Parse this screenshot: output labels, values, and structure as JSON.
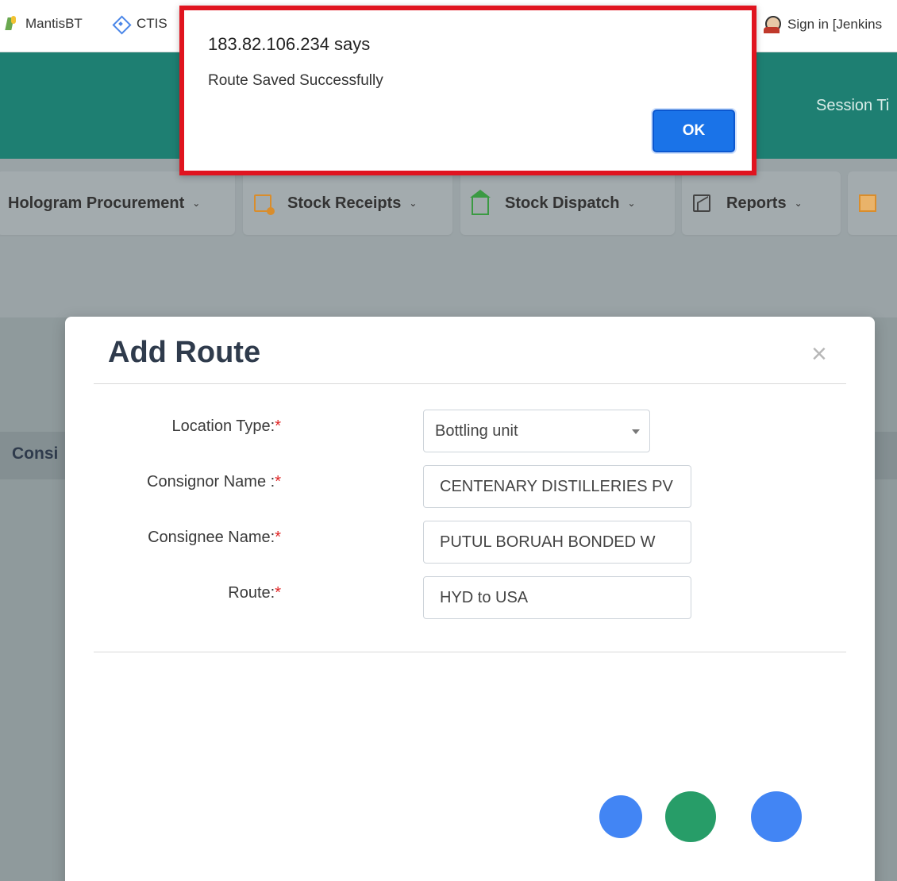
{
  "bookmarks": {
    "mantis": "MantisBT",
    "ctis": "CTIS",
    "jenkins": "Sign in [Jenkins"
  },
  "header": {
    "session": "Session Ti"
  },
  "nav": {
    "items": [
      {
        "label": "Hologram Procurement"
      },
      {
        "label": "Stock Receipts"
      },
      {
        "label": "Stock Dispatch"
      },
      {
        "label": "Reports"
      }
    ],
    "caret": "⌄"
  },
  "background": {
    "table_header": "Consi"
  },
  "modal": {
    "title": "Add Route",
    "close": "×",
    "fields": {
      "location_type": {
        "label": "Location Type:",
        "value": "Bottling unit"
      },
      "consignor": {
        "label": "Consignor Name :",
        "value": "CENTENARY DISTILLERIES PV"
      },
      "consignee": {
        "label": "Consignee Name:",
        "value": "PUTUL BORUAH BONDED W"
      },
      "route": {
        "label": "Route:",
        "value": "HYD to USA"
      }
    },
    "required_marker": "*"
  },
  "loader": {
    "colors": [
      "#4285f4",
      "#279d68",
      "#4285f4"
    ]
  },
  "alert": {
    "origin": "183.82.106.234 says",
    "message": "Route Saved Successfully",
    "ok_label": "OK",
    "border_color": "#e0141f"
  },
  "colors": {
    "header_teal": "#1e7f72",
    "ok_blue": "#1a73e8"
  }
}
